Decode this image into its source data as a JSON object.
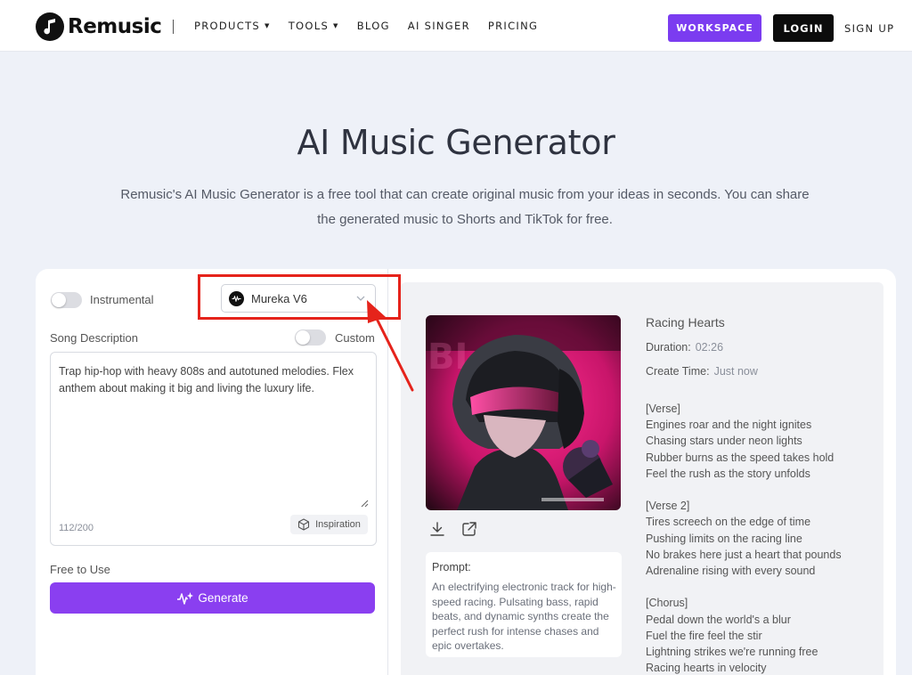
{
  "brand": {
    "name": "Remusic"
  },
  "nav": {
    "links": [
      {
        "label": "PRODUCTS",
        "dropdown": true
      },
      {
        "label": "TOOLS",
        "dropdown": true
      },
      {
        "label": "BLOG",
        "dropdown": false
      },
      {
        "label": "AI SINGER",
        "dropdown": false
      },
      {
        "label": "PRICING",
        "dropdown": false
      }
    ],
    "workspace_label": "WORKSPACE",
    "login_label": "LOGIN",
    "signup_label": "SIGN UP"
  },
  "hero": {
    "title": "AI Music Generator",
    "subtitle_line1": "Remusic's AI Music Generator is a free tool that can create original music from your ideas in seconds. You can share",
    "subtitle_line2": "the generated music to Shorts and TikTok for free."
  },
  "form": {
    "instrumental_label": "Instrumental",
    "instrumental_on": false,
    "model_selected": "Mureka V6",
    "song_description_label": "Song Description",
    "custom_label": "Custom",
    "custom_on": false,
    "description_value": "Trap hip-hop with heavy 808s and autotuned melodies. Flex anthem about making it big and living the luxury life.",
    "char_count": "112/200",
    "inspiration_label": "Inspiration",
    "free_label": "Free to Use",
    "generate_label": "Generate"
  },
  "result": {
    "title": "Racing Hearts",
    "duration_label": "Duration:",
    "duration_value": "02:26",
    "create_time_label": "Create Time:",
    "create_time_value": "Just now",
    "prompt_label": "Prompt:",
    "prompt_text": "An electrifying electronic track for high-speed racing. Pulsating bass, rapid beats, and dynamic synths create the perfect rush for intense chases and epic overtakes.",
    "lyrics": [
      "[Verse]",
      "Engines roar and the night ignites",
      "Chasing stars under neon lights",
      "Rubber burns as the speed takes hold",
      "Feel the rush as the story unfolds",
      "",
      "[Verse 2]",
      "Tires screech on the edge of time",
      "Pushing limits on the racing line",
      "No brakes here just a heart that pounds",
      "Adrenaline rising with every sound",
      "",
      "[Chorus]",
      "Pedal down the world's a blur",
      "Fuel the fire feel the stir",
      "Lightning strikes we're running free",
      "Racing hearts in velocity"
    ]
  },
  "colors": {
    "accent": "#8a3ff0",
    "workspace": "#7b3cf0",
    "highlight": "#e5231b"
  }
}
